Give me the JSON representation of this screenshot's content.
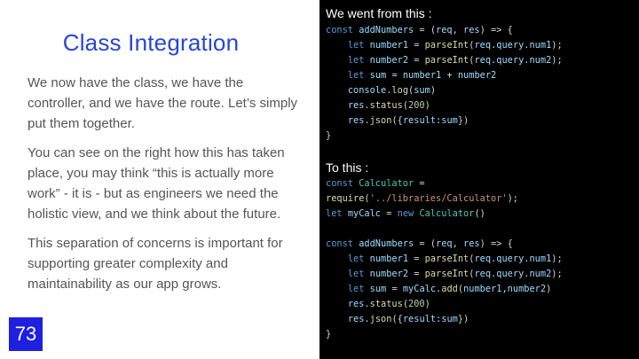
{
  "slide": {
    "title": "Class Integration",
    "paragraphs": [
      "We now have the class, we have the controller, and we have the route. Let’s simply put them together.",
      "You can see on the right how this has taken place, you may think “this is actually more work” - it is - but as engineers we need the holistic view, and we think about the future.",
      "This separation of concerns is important for supporting greater complexity and maintainability as our app grows."
    ],
    "page_number": "73"
  },
  "code_panel": {
    "before_heading": "We went from this :",
    "before_code": [
      "const addNumbers = (req, res) => {",
      "    let number1 = parseInt(req.query.num1);",
      "    let number2 = parseInt(req.query.num2);",
      "    let sum = number1 + number2",
      "    console.log(sum)",
      "    res.status(200)",
      "    res.json({result:sum})",
      "}"
    ],
    "after_heading": "To this :",
    "after_code": [
      "const Calculator =",
      "require('../libraries/Calculator');",
      "let myCalc = new Calculator()",
      "",
      "const addNumbers = (req, res) => {",
      "    let number1 = parseInt(req.query.num1);",
      "    let number2 = parseInt(req.query.num2);",
      "    let sum = myCalc.add(number1,number2)",
      "    res.status(200)",
      "    res.json({result:sum})",
      "}"
    ],
    "colors": {
      "background": "#000000",
      "keyword": "#569cd6",
      "function": "#dcdcaa",
      "variable": "#9cdcfe",
      "class": "#4ec9b0",
      "string": "#ce9178",
      "number": "#b5cea8"
    }
  },
  "colors": {
    "title": "#2646d8",
    "body_text": "#555555",
    "badge_bg": "#1f1fe0"
  }
}
